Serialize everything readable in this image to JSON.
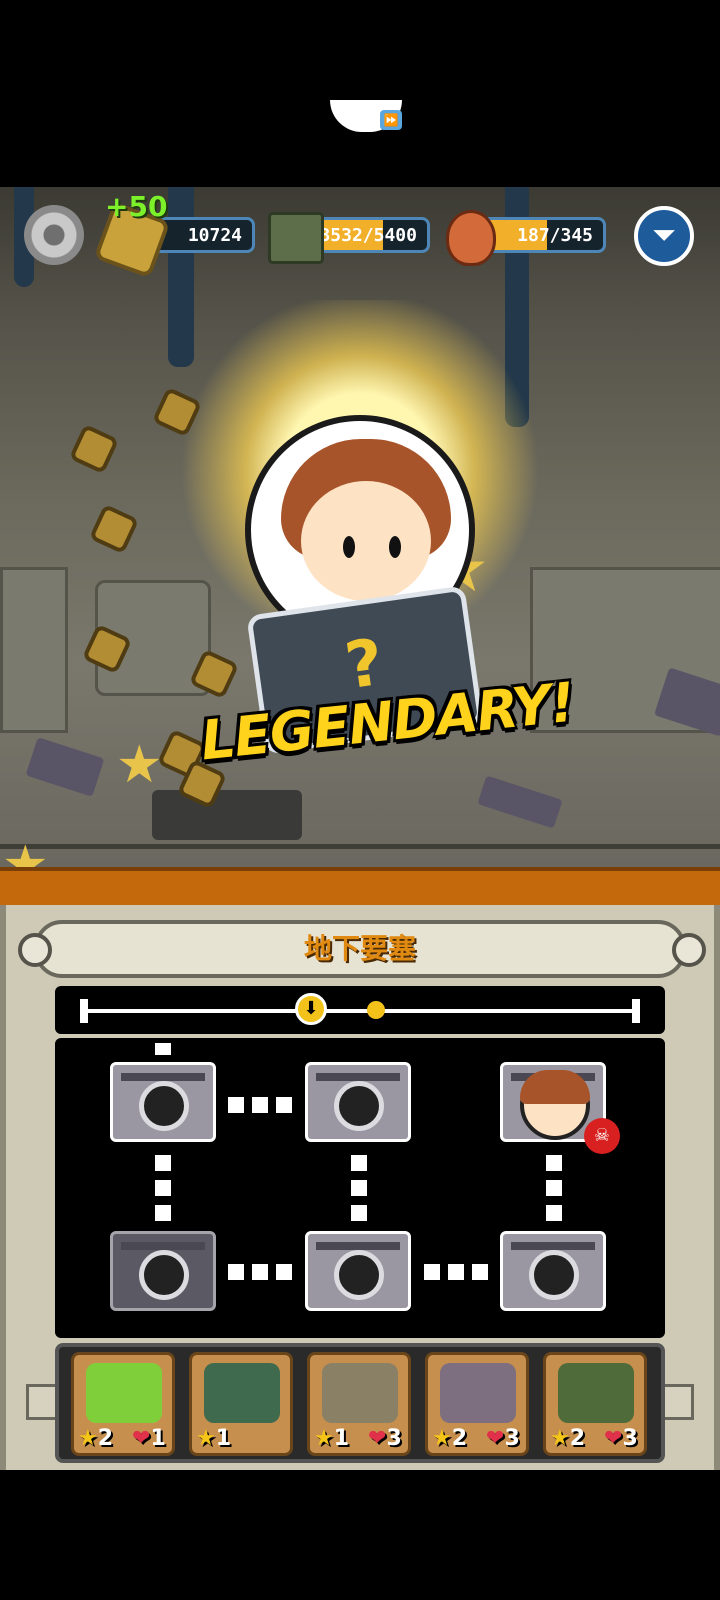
{
  "hud": {
    "bonus": "+50",
    "nuts": "10724",
    "supplies": "3532/5400",
    "food": "187/345",
    "supplies_fill": 0.654,
    "food_fill": 0.542
  },
  "reward": {
    "card_symbol": "?",
    "rarity": "LEGENDARY!"
  },
  "panel": {
    "title": "地下要塞",
    "progress_marker": "⬇"
  },
  "inventory": [
    {
      "stars": "2",
      "hearts": "1",
      "icon": "green-pot-icon",
      "color": "#7fcf3a"
    },
    {
      "stars": "1",
      "hearts": "",
      "icon": "mystery-crate-icon",
      "color": "#3f6a4e"
    },
    {
      "stars": "1",
      "hearts": "3",
      "icon": "sack-icon",
      "color": "#8a8066"
    },
    {
      "stars": "2",
      "hearts": "3",
      "icon": "poison-bottle-icon",
      "color": "#7d6e80"
    },
    {
      "stars": "2",
      "hearts": "3",
      "icon": "grenade-launcher-icon",
      "color": "#4f6b3a"
    }
  ],
  "icons": {
    "star": "★",
    "heart": "❤",
    "skull": "☠",
    "drop": "⏷",
    "fast_forward": "⏩"
  }
}
